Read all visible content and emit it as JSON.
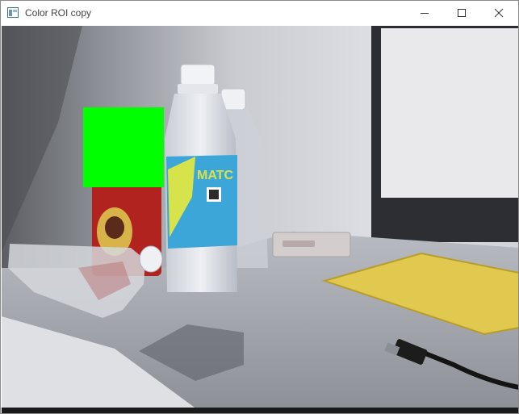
{
  "window": {
    "title": "Color ROI copy"
  },
  "controls": {
    "minimize_icon": "minimize-icon",
    "maximize_icon": "maximize-icon",
    "close_icon": "close-icon"
  },
  "image": {
    "roi_color": "#00ff00",
    "background_color": "#9ea0a6"
  }
}
